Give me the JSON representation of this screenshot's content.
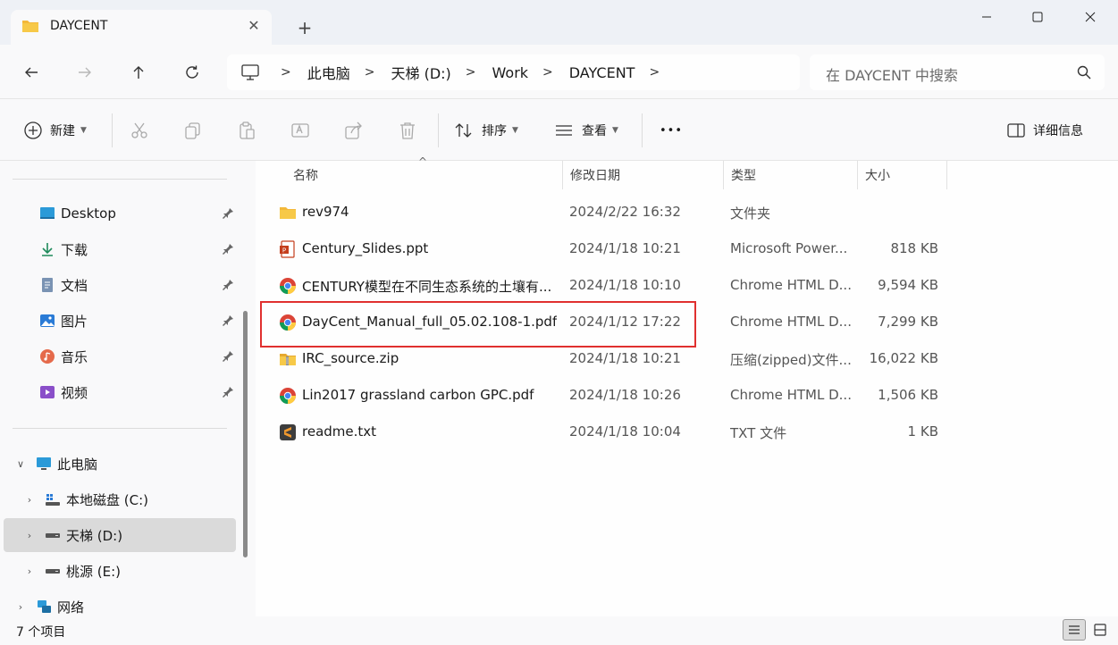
{
  "window": {
    "tab_title": "DAYCENT",
    "close_tab": "✕",
    "new_tab": "+",
    "controls": [
      "minimize",
      "maximize",
      "close"
    ]
  },
  "navigation": {
    "breadcrumbs": [
      "此电脑",
      "天梯 (D:)",
      "Work",
      "DAYCENT"
    ],
    "search_placeholder": "在 DAYCENT 中搜索"
  },
  "toolbar": {
    "new_label": "新建",
    "sort_label": "排序",
    "view_label": "查看",
    "more_label": "•••",
    "details_label": "详细信息"
  },
  "sidebar": {
    "quick": [
      {
        "label": "Desktop",
        "icon": "desktop-icon"
      },
      {
        "label": "下载",
        "icon": "download-icon"
      },
      {
        "label": "文档",
        "icon": "document-icon"
      },
      {
        "label": "图片",
        "icon": "picture-icon"
      },
      {
        "label": "音乐",
        "icon": "music-icon"
      },
      {
        "label": "视频",
        "icon": "video-icon"
      }
    ],
    "this_pc": "此电脑",
    "drives": [
      {
        "label": "本地磁盘 (C:)"
      },
      {
        "label": "天梯 (D:)"
      },
      {
        "label": "桃源 (E:)"
      }
    ],
    "network": "网络"
  },
  "columns": [
    "名称",
    "修改日期",
    "类型",
    "大小"
  ],
  "files": [
    {
      "name": "rev974",
      "date": "2024/2/22 16:32",
      "type": "文件夹",
      "size": "",
      "icon": "folder-icon"
    },
    {
      "name": "Century_Slides.ppt",
      "date": "2024/1/18 10:21",
      "type": "Microsoft Power...",
      "size": "818 KB",
      "icon": "ppt-icon"
    },
    {
      "name": "CENTURY模型在不同生态系统的土壤有...",
      "date": "2024/1/18 10:10",
      "type": "Chrome HTML D...",
      "size": "9,594 KB",
      "icon": "chrome-icon"
    },
    {
      "name": "DayCent_Manual_full_05.02.108-1.pdf",
      "date": "2024/1/12 17:22",
      "type": "Chrome HTML D...",
      "size": "7,299 KB",
      "icon": "chrome-icon"
    },
    {
      "name": "IRC_source.zip",
      "date": "2024/1/18 10:21",
      "type": "压缩(zipped)文件...",
      "size": "16,022 KB",
      "icon": "zip-icon"
    },
    {
      "name": "Lin2017 grassland carbon GPC.pdf",
      "date": "2024/1/18 10:26",
      "type": "Chrome HTML D...",
      "size": "1,506 KB",
      "icon": "chrome-icon"
    },
    {
      "name": "readme.txt",
      "date": "2024/1/18 10:04",
      "type": "TXT 文件",
      "size": "1 KB",
      "icon": "sublime-icon"
    }
  ],
  "status": {
    "count": "7 个项目"
  },
  "colors": {
    "highlight": "#e0302f",
    "folder": "#f7c948"
  }
}
